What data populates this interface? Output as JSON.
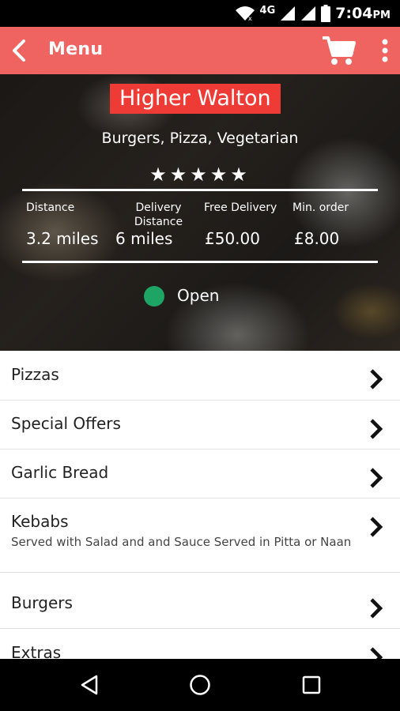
{
  "status_bar": {
    "network": "4G",
    "time": "7:04",
    "ampm": "PM",
    "icons": [
      "wifi-icon",
      "signal-icon",
      "signal-icon",
      "battery-icon"
    ]
  },
  "app_bar": {
    "title": "Menu",
    "icons": [
      "back-arrow-icon",
      "cart-icon",
      "more-vert-icon"
    ],
    "color": "#ef6461"
  },
  "restaurant": {
    "name": "Higher Walton",
    "cuisine": "Burgers, Pizza, Vegetarian",
    "rating_stars": 5,
    "stars_text": "★★★★★",
    "stats": [
      {
        "label": "Distance",
        "value": "3.2 miles"
      },
      {
        "label": "Delivery Distance",
        "value": "6 miles"
      },
      {
        "label": "Free Delivery",
        "value": "£50.00"
      },
      {
        "label": "Min. order",
        "value": "£8.00"
      }
    ],
    "status": "Open",
    "status_color": "#1ea465",
    "name_bg": "#ef3b36"
  },
  "menu": [
    {
      "label": "Pizzas",
      "description": ""
    },
    {
      "label": "Special Offers",
      "description": ""
    },
    {
      "label": "Garlic Bread",
      "description": ""
    },
    {
      "label": "Kebabs",
      "description": "Served with Salad and and Sauce Served in Pitta or Naan"
    },
    {
      "label": "Burgers",
      "description": ""
    },
    {
      "label": "Extras",
      "description": ""
    }
  ],
  "nav_bar": {
    "icons": [
      "back-triangle-icon",
      "home-circle-icon",
      "recents-square-icon"
    ]
  }
}
